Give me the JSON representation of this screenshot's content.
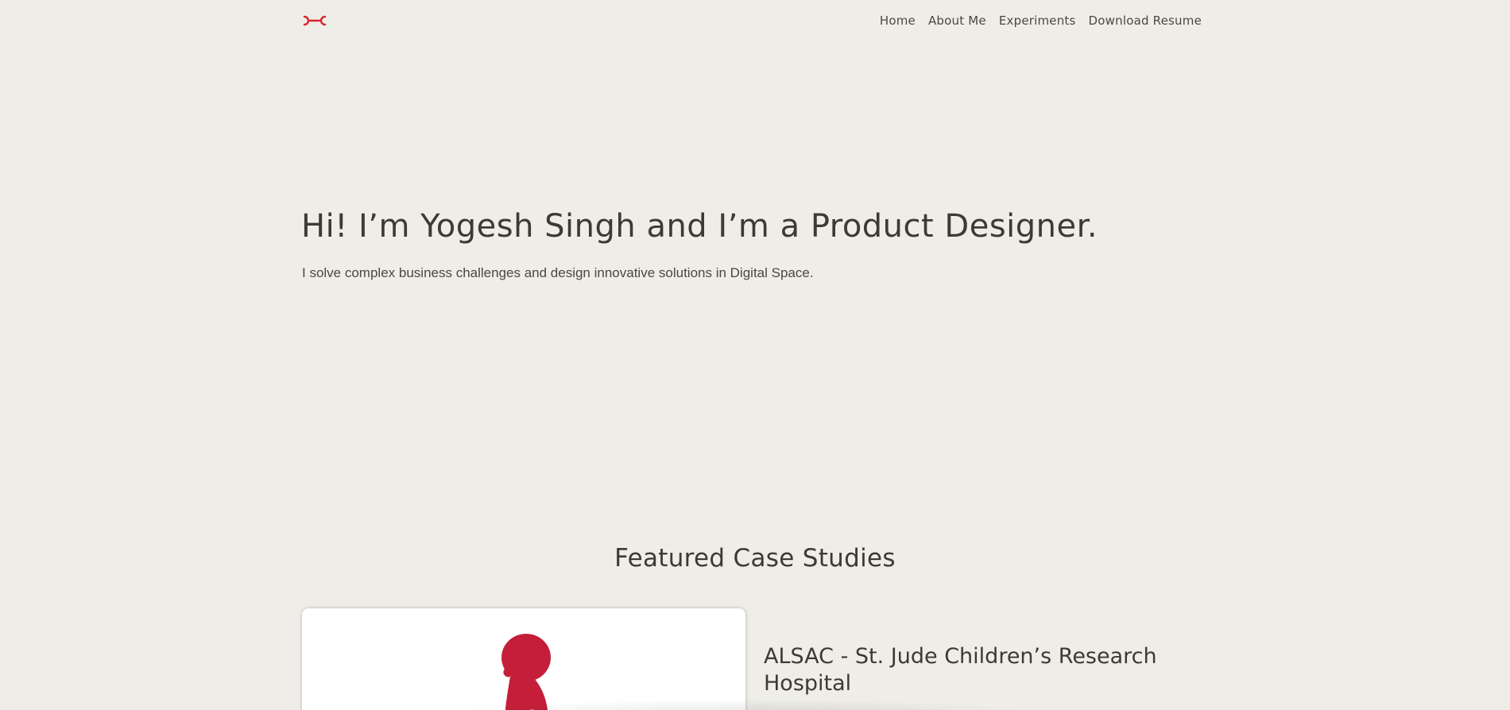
{
  "header": {
    "logo_icon": "yc-monogram-logo",
    "nav": [
      {
        "label": "Home"
      },
      {
        "label": "About Me"
      },
      {
        "label": "Experiments"
      },
      {
        "label": "Download Resume"
      }
    ]
  },
  "hero": {
    "title": "Hi! I’m Yogesh Singh and I’m a Product Designer.",
    "subtitle": "I solve complex business challenges and design innovative solutions in Digital Space."
  },
  "featured": {
    "heading": "Featured Case Studies",
    "cases": [
      {
        "title": "ALSAC - St. Jude Children’s Research Hospital",
        "image_icon": "st-jude-child-silhouette-icon"
      }
    ]
  },
  "colors": {
    "background": "#eeede8",
    "text": "#3d3b30",
    "accent": "#d6242e",
    "st_jude_red": "#c41e3a"
  }
}
